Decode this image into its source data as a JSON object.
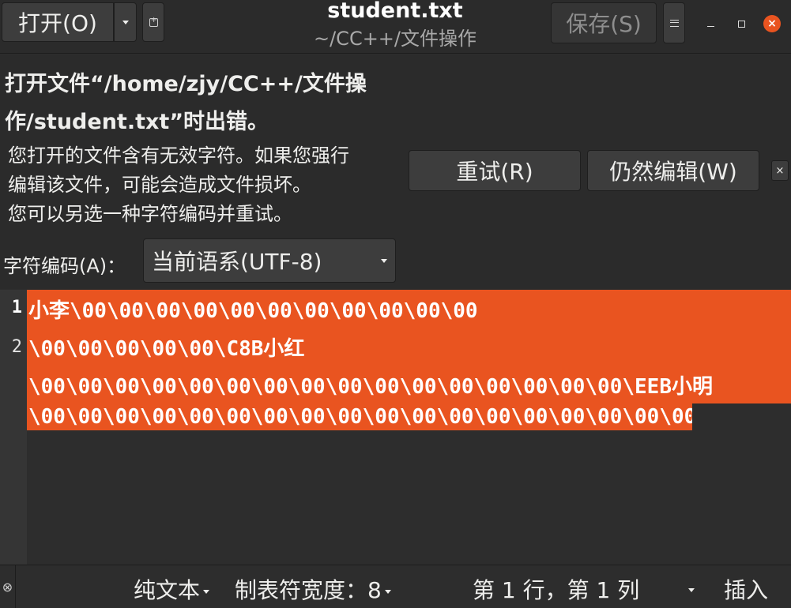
{
  "header": {
    "open_label": "打开(O)",
    "save_label": "保存(S)",
    "title": "student.txt",
    "subtitle": "~/CC++/文件操作",
    "close_glyph": "×"
  },
  "infobar": {
    "error_title": "打开文件“/home/zjy/CC++/文件操作/student.txt”时出错。",
    "error_desc_1": "您打开的文件含有无效字符。如果您强行",
    "error_desc_2": "编辑该文件，可能会造成文件损坏。",
    "error_desc_3": "您可以另选一种字符编码并重试。",
    "retry_label": "重试(R)",
    "edit_anyway_label": "仍然编辑(W)",
    "close_glyph": "×",
    "encoding_label": "字符编码(A)：",
    "encoding_value": "当前语系(UTF-8)"
  },
  "editor": {
    "line_numbers": [
      "1",
      "2"
    ],
    "lines": [
      "小李\\00\\00\\00\\00\\00\\00\\00\\00\\00\\00\\00",
      "\\00\\00\\00\\00\\00\\C8B小红",
      "\\00\\00\\00\\00\\00\\00\\00\\00\\00\\00\\00\u000e\\00\\00\\00\\00\\00\\EEB小明",
      "\\00\\00\\00\\00\\00\\00\\00\\00\\00\\00\\00\u000f\\00\\00\\00\\00\\00\\00\\00\\00"
    ]
  },
  "statusbar": {
    "toggle_glyph": "⊗",
    "language": "纯文本",
    "tab_width": "制表符宽度：8",
    "position": "第 1 行，第 1 列",
    "mode": "插入"
  },
  "colors": {
    "accent": "#e95420",
    "background": "#2d2d2d",
    "headerbar": "#2b2b2b",
    "button": "#3d3d3d"
  }
}
